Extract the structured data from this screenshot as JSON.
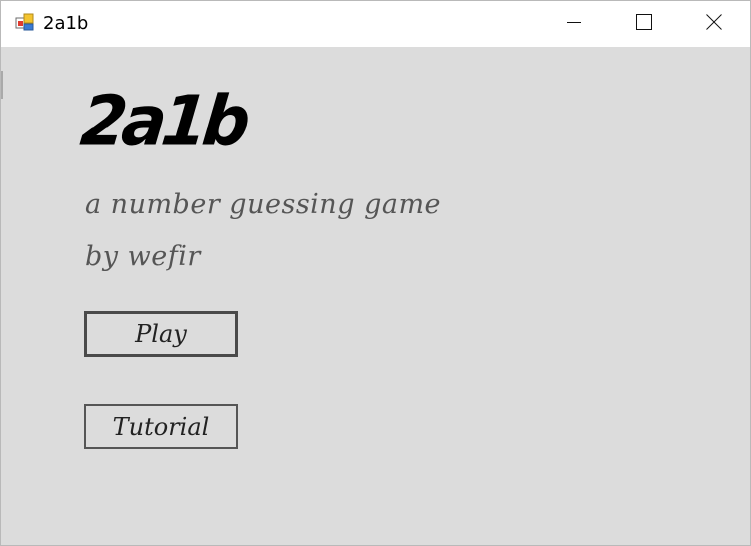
{
  "window": {
    "title": "2a1b",
    "controls": {
      "minimize": "minimize-icon",
      "maximize": "maximize-icon",
      "close": "close-icon"
    }
  },
  "main": {
    "logo": "2a1b",
    "subtitle_line1": "a number guessing game",
    "subtitle_line2": "by wefir",
    "play_label": "Play",
    "tutorial_label": "Tutorial"
  },
  "colors": {
    "background": "#dcdcdc",
    "subtitle_text": "#555555",
    "button_border": "#4a4a4a"
  }
}
